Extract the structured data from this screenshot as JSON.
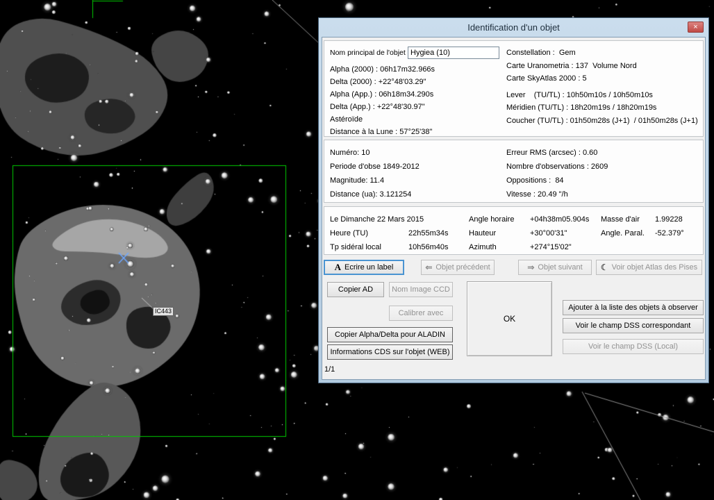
{
  "window": {
    "title": "Identification d'un objet",
    "footer": "1/1"
  },
  "icons": {
    "close": "×",
    "write_label": "A",
    "prev": "⇐",
    "next": "⇒",
    "moon": "☾"
  },
  "identity": {
    "name_label": "Nom principal de l'objet",
    "name_value": "Hygiea (10)",
    "left_rows": [
      "Alpha (2000) : 06h17m32.966s",
      "Delta (2000) : +22°48'03.29\"",
      "Alpha (App.) : 06h18m34.290s",
      "Delta (App.) : +22°48'30.97\"",
      "Astéroïde",
      "Distance à la Lune : 57°25'38\""
    ],
    "right_rows": [
      "Constellation :  Gem",
      "Carte Uranometria : 137  Volume Nord",
      "Carte SkyAtlas 2000 : 5",
      "Lever    (TU/TL) : 10h50m10s / 10h50m10s",
      "Méridien (TU/TL) : 18h20m19s / 18h20m19s",
      "Coucher (TU/TL) : 01h50m28s (J+1)  / 01h50m28s (J+1)"
    ]
  },
  "orbit": {
    "left_rows": [
      "Numéro: 10",
      "Periode d'obse 1849-2012",
      "Magnitude: 11.4",
      "Distance (ua): 3.121254"
    ],
    "right_rows": [
      "Erreur RMS (arcsec) : 0.60",
      "Nombre d'observations : 2609",
      "Oppositions :  84",
      "Vitesse : 20.49 \"/h"
    ]
  },
  "ephemeris": {
    "date": "Le Dimanche 22 Mars 2015",
    "time_rows": [
      {
        "label": "Heure (TU)",
        "value": "22h55m34s"
      },
      {
        "label": "Tp sidéral local",
        "value": "10h56m40s"
      }
    ],
    "coord_rows": [
      {
        "label": "Angle horaire",
        "value": "+04h38m05.904s"
      },
      {
        "label": "Hauteur",
        "value": "+30°00'31\""
      },
      {
        "label": "Azimuth",
        "value": "+274°15'02\""
      }
    ],
    "air_rows": [
      {
        "label": "Masse d'air",
        "value": "1.99228"
      },
      {
        "label": "Angle. Paral.",
        "value": "-52.379°"
      }
    ]
  },
  "actions": {
    "write_label": "Ecrire un label",
    "prev_object": "Objet précédent",
    "next_object": "Objet suivant",
    "atlas": "Voir objet Atlas des Pises"
  },
  "tools": {
    "copy_ad": "Copier AD",
    "ccd_name": "Nom Image CCD",
    "calibrate": "Calibrer avec",
    "copy_aladin": "Copier Alpha/Delta pour ALADIN",
    "cds_info": "Informations CDS sur l'objet (WEB)",
    "ok": "OK",
    "add_to_list": "Ajouter à la liste des objets à observer",
    "dss_field": "Voir le champ DSS correspondant",
    "dss_local": "Voir le champ DSS (Local)"
  },
  "map": {
    "nebula_label": "IC443",
    "fov_color": "#00cc00",
    "marker_color": "#6fa8ff",
    "line_color": "#909090"
  }
}
